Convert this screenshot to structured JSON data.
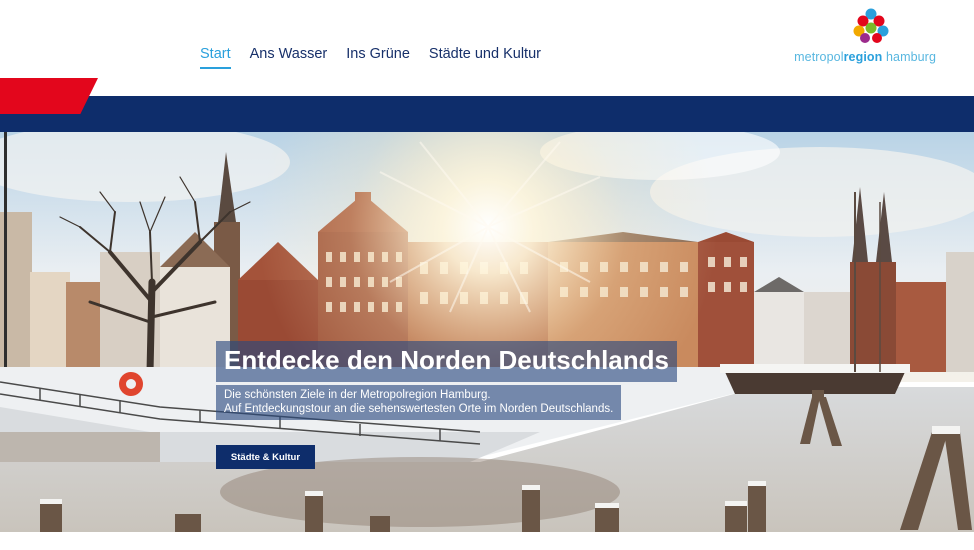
{
  "nav": {
    "items": [
      {
        "label": "Start",
        "active": true
      },
      {
        "label": "Ans Wasser",
        "active": false
      },
      {
        "label": "Ins Grüne",
        "active": false
      },
      {
        "label": "Städte und Kultur",
        "active": false
      }
    ]
  },
  "logo": {
    "text_prefix": "metropol",
    "text_bold": "region",
    "text_suffix": " hamburg",
    "icon": "metropolregion-logo-icon"
  },
  "hero": {
    "title": "Entdecke den Norden Deutschlands",
    "subtitle_line1": "Die schönsten Ziele in der Metropolregion Hamburg.",
    "subtitle_line2": "Auf Entdeckungstour an die sehenswertesten Orte im Norden Deutschlands.",
    "button_label": "Städte & Kultur"
  },
  "colors": {
    "navy": "#0e2d6b",
    "red": "#e3061c",
    "accent_blue": "#2aa0dc"
  }
}
